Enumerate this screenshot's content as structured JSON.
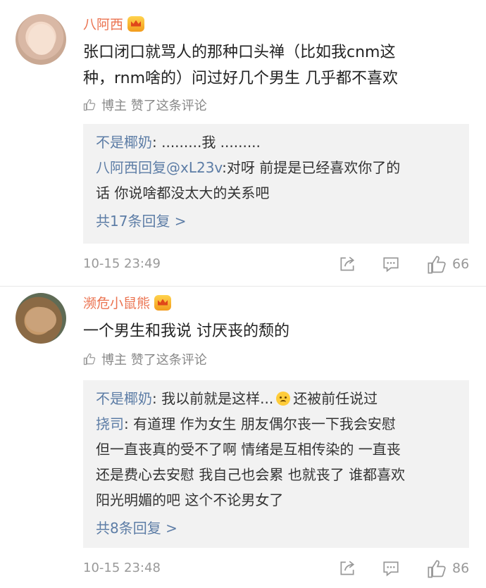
{
  "comments": [
    {
      "username": "八阿西",
      "text_lines": [
        "张口闭口就骂人的那种口头禅（比如我cnm这",
        "种，rnm啥的）问过好几个男生 几乎都不喜欢"
      ],
      "liked_label": "博主 赞了这条评论",
      "replies": [
        {
          "name": "不是椰奶",
          "sep": ": ",
          "lines": [
            ".........我 ........."
          ]
        },
        {
          "name": "八阿西回复@xL23v",
          "sep": ":",
          "lines": [
            "对呀 前提是已经喜欢你了的",
            "话 你说啥都没太大的关系吧"
          ]
        }
      ],
      "more_label": "共17条回复 >",
      "time": "10-15 23:49",
      "like_count": "66"
    },
    {
      "username": "濒危小鼠熊",
      "text_lines": [
        "一个男生和我说 讨厌丧的颓的"
      ],
      "liked_label": "博主 赞了这条评论",
      "replies": [
        {
          "name": "不是椰奶",
          "sep": ": ",
          "lines": [
            "我以前就是这样...",
            "还被前任说过"
          ]
        },
        {
          "name": "挠司",
          "sep": ": ",
          "lines": [
            "有道理 作为女生 朋友偶尔丧一下我会安慰",
            "但一直丧真的受不了啊 情绪是互相传染的 一直丧",
            "还是费心去安慰 我自己也会累 也就丧了 谁都喜欢",
            "阳光明媚的吧 这个不论男女了"
          ]
        }
      ],
      "more_label": "共8条回复 >",
      "time": "10-15 23:48",
      "like_count": "86"
    }
  ],
  "colors": {
    "username": "#eb7350",
    "reply_name": "#5d7da6",
    "reply_bg": "#f2f2f2"
  },
  "icons": [
    "thumb-up-icon",
    "repost-icon",
    "comment-icon",
    "crown-badge-icon",
    "worried-face-emoji"
  ]
}
